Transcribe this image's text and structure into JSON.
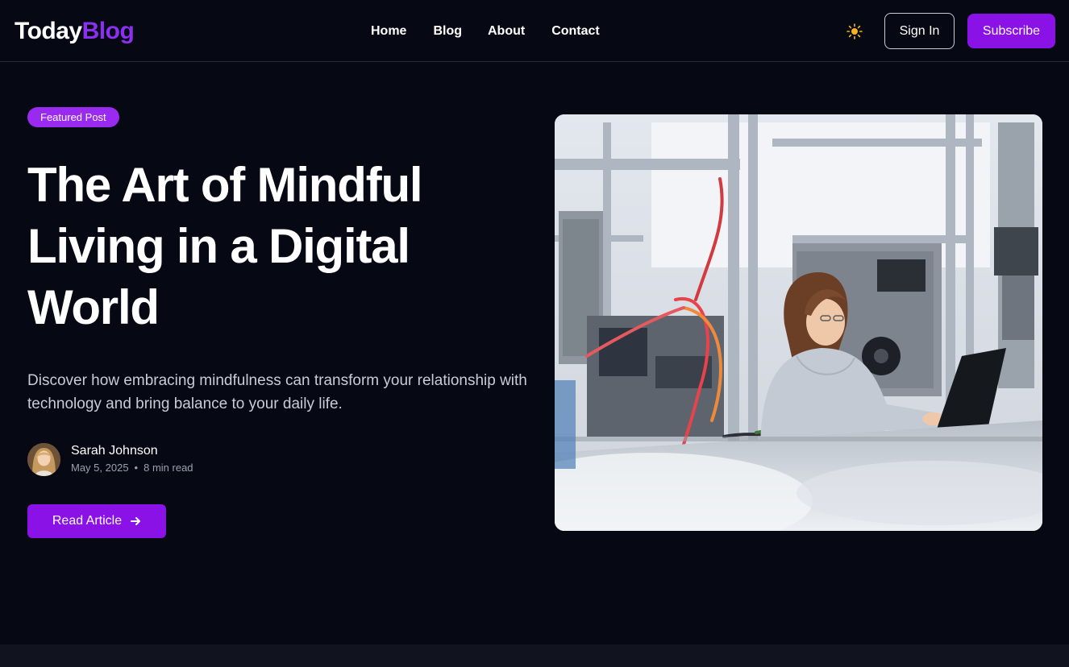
{
  "header": {
    "logo_part1": "Today",
    "logo_part2": "Blog",
    "nav": [
      "Home",
      "Blog",
      "About",
      "Contact"
    ],
    "theme_icon": "sun-icon",
    "signin_label": "Sign In",
    "subscribe_label": "Subscribe"
  },
  "hero": {
    "badge": "Featured Post",
    "title": "The Art of Mindful Living in a Digital World",
    "description": "Discover how embracing mindfulness can transform your relationship with technology and bring balance to your daily life.",
    "author": {
      "name": "Sarah Johnson",
      "date": "May 5, 2025",
      "separator": "•",
      "read_time": "8 min read"
    },
    "cta_label": "Read Article",
    "cta_icon": "arrow-right-icon",
    "image_subject": "engineer-working-on-laptop-in-lab"
  },
  "colors": {
    "background": "#060814",
    "accent": "#8b12e6",
    "accent_light": "#8b2ff0",
    "badge": "#9a2af0",
    "muted_text": "#c9ccd6",
    "meta_text": "#9aa0ae",
    "sun": "#f5b321"
  }
}
